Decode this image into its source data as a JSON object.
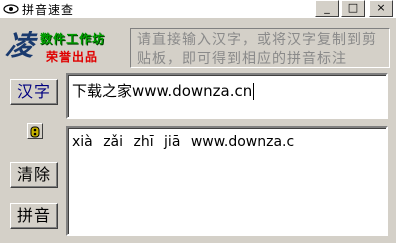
{
  "window": {
    "title": "拼音速查",
    "controls": {
      "minimize": "_",
      "maximize": "□",
      "close": "×"
    }
  },
  "logo": {
    "big_char": "凌",
    "line1": "数件工作坊",
    "line2": "荣誉出品"
  },
  "instructions": "请直接输入汉字，或将汉字复制到剪贴板，即可得到相应的拼音标注",
  "buttons": {
    "hanzi": "汉字",
    "clear": "清除",
    "pinyin": "拼音"
  },
  "input": {
    "value": "下载之家www.downza.cn"
  },
  "output": {
    "value": "xià  zǎi  zhī  jiā  www.downza.c"
  }
}
